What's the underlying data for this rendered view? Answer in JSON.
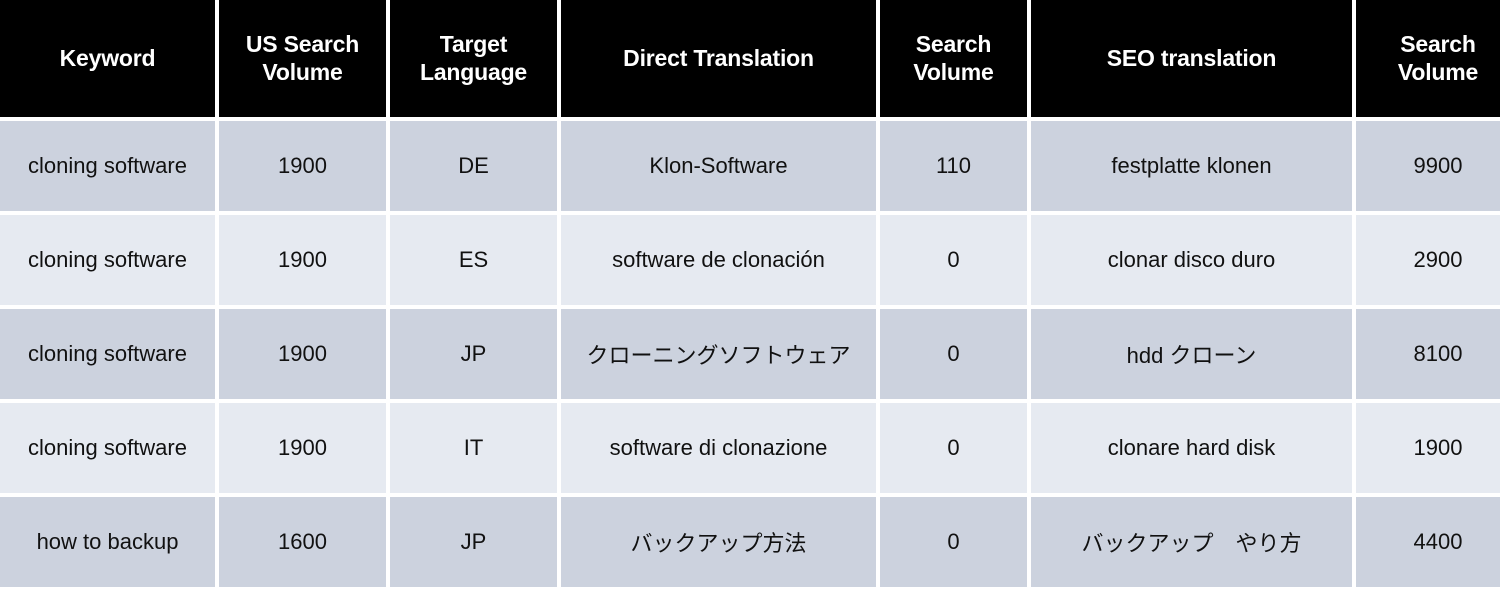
{
  "table": {
    "columns": [
      {
        "key": "keyword",
        "label": "Keyword"
      },
      {
        "key": "us_search_volume",
        "label": "US Search\nVolume"
      },
      {
        "key": "target_language",
        "label": "Target\nLanguage"
      },
      {
        "key": "direct_translation",
        "label": "Direct Translation"
      },
      {
        "key": "direct_volume",
        "label": "Search\nVolume"
      },
      {
        "key": "seo_translation",
        "label": "SEO translation"
      },
      {
        "key": "seo_volume",
        "label": "Search\nVolume"
      }
    ],
    "header_lines": [
      [
        "Keyword"
      ],
      [
        "US Search",
        "Volume"
      ],
      [
        "Target",
        "Language"
      ],
      [
        "Direct Translation"
      ],
      [
        "Search",
        "Volume"
      ],
      [
        "SEO translation"
      ],
      [
        "Search",
        "Volume"
      ]
    ],
    "rows": [
      {
        "keyword": "cloning software",
        "us_search_volume": "1900",
        "target_language": "DE",
        "direct_translation": "Klon-Software",
        "direct_volume": "110",
        "seo_translation": "festplatte klonen",
        "seo_volume": "9900"
      },
      {
        "keyword": "cloning software",
        "us_search_volume": "1900",
        "target_language": "ES",
        "direct_translation": "software de clonación",
        "direct_volume": "0",
        "seo_translation": "clonar disco duro",
        "seo_volume": "2900"
      },
      {
        "keyword": "cloning software",
        "us_search_volume": "1900",
        "target_language": "JP",
        "direct_translation": "クローニングソフトウェア",
        "direct_volume": "0",
        "seo_translation": "hdd クローン",
        "seo_volume": "8100"
      },
      {
        "keyword": "cloning software",
        "us_search_volume": "1900",
        "target_language": "IT",
        "direct_translation": "software di clonazione",
        "direct_volume": "0",
        "seo_translation": "clonare hard disk",
        "seo_volume": "1900"
      },
      {
        "keyword": "how to backup",
        "us_search_volume": "1600",
        "target_language": "JP",
        "direct_translation": "バックアップ方法",
        "direct_volume": "0",
        "seo_translation": "バックアップ　やり方",
        "seo_volume": "4400"
      }
    ],
    "colors": {
      "header_background": "#000000",
      "header_text": "#ffffff",
      "row_odd_background": "#ccd2de",
      "row_even_background": "#e6eaf1",
      "cell_text": "#111111",
      "gap": "#ffffff"
    }
  }
}
